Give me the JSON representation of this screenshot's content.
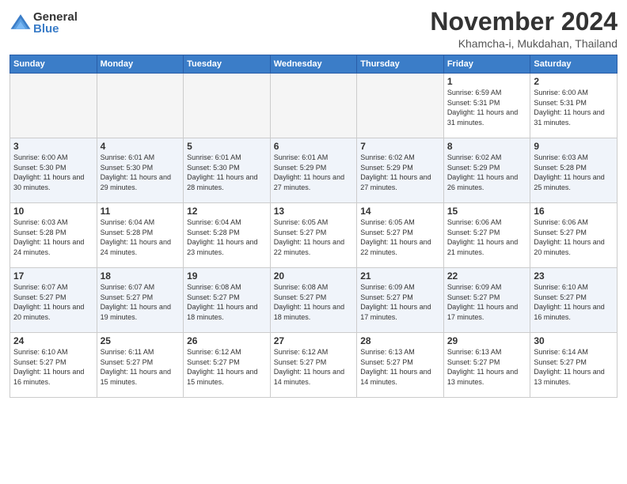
{
  "logo": {
    "general": "General",
    "blue": "Blue"
  },
  "header": {
    "month": "November 2024",
    "location": "Khamcha-i, Mukdahan, Thailand"
  },
  "weekdays": [
    "Sunday",
    "Monday",
    "Tuesday",
    "Wednesday",
    "Thursday",
    "Friday",
    "Saturday"
  ],
  "weeks": [
    [
      {
        "day": "",
        "empty": true
      },
      {
        "day": "",
        "empty": true
      },
      {
        "day": "",
        "empty": true
      },
      {
        "day": "",
        "empty": true
      },
      {
        "day": "",
        "empty": true
      },
      {
        "day": "1",
        "sunrise": "6:59 AM",
        "sunset": "5:31 PM",
        "daylight": "11 hours and 31 minutes."
      },
      {
        "day": "2",
        "sunrise": "6:00 AM",
        "sunset": "5:31 PM",
        "daylight": "11 hours and 31 minutes."
      }
    ],
    [
      {
        "day": "3",
        "sunrise": "6:00 AM",
        "sunset": "5:30 PM",
        "daylight": "11 hours and 30 minutes."
      },
      {
        "day": "4",
        "sunrise": "6:01 AM",
        "sunset": "5:30 PM",
        "daylight": "11 hours and 29 minutes."
      },
      {
        "day": "5",
        "sunrise": "6:01 AM",
        "sunset": "5:30 PM",
        "daylight": "11 hours and 28 minutes."
      },
      {
        "day": "6",
        "sunrise": "6:01 AM",
        "sunset": "5:29 PM",
        "daylight": "11 hours and 27 minutes."
      },
      {
        "day": "7",
        "sunrise": "6:02 AM",
        "sunset": "5:29 PM",
        "daylight": "11 hours and 27 minutes."
      },
      {
        "day": "8",
        "sunrise": "6:02 AM",
        "sunset": "5:29 PM",
        "daylight": "11 hours and 26 minutes."
      },
      {
        "day": "9",
        "sunrise": "6:03 AM",
        "sunset": "5:28 PM",
        "daylight": "11 hours and 25 minutes."
      }
    ],
    [
      {
        "day": "10",
        "sunrise": "6:03 AM",
        "sunset": "5:28 PM",
        "daylight": "11 hours and 24 minutes."
      },
      {
        "day": "11",
        "sunrise": "6:04 AM",
        "sunset": "5:28 PM",
        "daylight": "11 hours and 24 minutes."
      },
      {
        "day": "12",
        "sunrise": "6:04 AM",
        "sunset": "5:28 PM",
        "daylight": "11 hours and 23 minutes."
      },
      {
        "day": "13",
        "sunrise": "6:05 AM",
        "sunset": "5:27 PM",
        "daylight": "11 hours and 22 minutes."
      },
      {
        "day": "14",
        "sunrise": "6:05 AM",
        "sunset": "5:27 PM",
        "daylight": "11 hours and 22 minutes."
      },
      {
        "day": "15",
        "sunrise": "6:06 AM",
        "sunset": "5:27 PM",
        "daylight": "11 hours and 21 minutes."
      },
      {
        "day": "16",
        "sunrise": "6:06 AM",
        "sunset": "5:27 PM",
        "daylight": "11 hours and 20 minutes."
      }
    ],
    [
      {
        "day": "17",
        "sunrise": "6:07 AM",
        "sunset": "5:27 PM",
        "daylight": "11 hours and 20 minutes."
      },
      {
        "day": "18",
        "sunrise": "6:07 AM",
        "sunset": "5:27 PM",
        "daylight": "11 hours and 19 minutes."
      },
      {
        "day": "19",
        "sunrise": "6:08 AM",
        "sunset": "5:27 PM",
        "daylight": "11 hours and 18 minutes."
      },
      {
        "day": "20",
        "sunrise": "6:08 AM",
        "sunset": "5:27 PM",
        "daylight": "11 hours and 18 minutes."
      },
      {
        "day": "21",
        "sunrise": "6:09 AM",
        "sunset": "5:27 PM",
        "daylight": "11 hours and 17 minutes."
      },
      {
        "day": "22",
        "sunrise": "6:09 AM",
        "sunset": "5:27 PM",
        "daylight": "11 hours and 17 minutes."
      },
      {
        "day": "23",
        "sunrise": "6:10 AM",
        "sunset": "5:27 PM",
        "daylight": "11 hours and 16 minutes."
      }
    ],
    [
      {
        "day": "24",
        "sunrise": "6:10 AM",
        "sunset": "5:27 PM",
        "daylight": "11 hours and 16 minutes."
      },
      {
        "day": "25",
        "sunrise": "6:11 AM",
        "sunset": "5:27 PM",
        "daylight": "11 hours and 15 minutes."
      },
      {
        "day": "26",
        "sunrise": "6:12 AM",
        "sunset": "5:27 PM",
        "daylight": "11 hours and 15 minutes."
      },
      {
        "day": "27",
        "sunrise": "6:12 AM",
        "sunset": "5:27 PM",
        "daylight": "11 hours and 14 minutes."
      },
      {
        "day": "28",
        "sunrise": "6:13 AM",
        "sunset": "5:27 PM",
        "daylight": "11 hours and 14 minutes."
      },
      {
        "day": "29",
        "sunrise": "6:13 AM",
        "sunset": "5:27 PM",
        "daylight": "11 hours and 13 minutes."
      },
      {
        "day": "30",
        "sunrise": "6:14 AM",
        "sunset": "5:27 PM",
        "daylight": "11 hours and 13 minutes."
      }
    ]
  ]
}
